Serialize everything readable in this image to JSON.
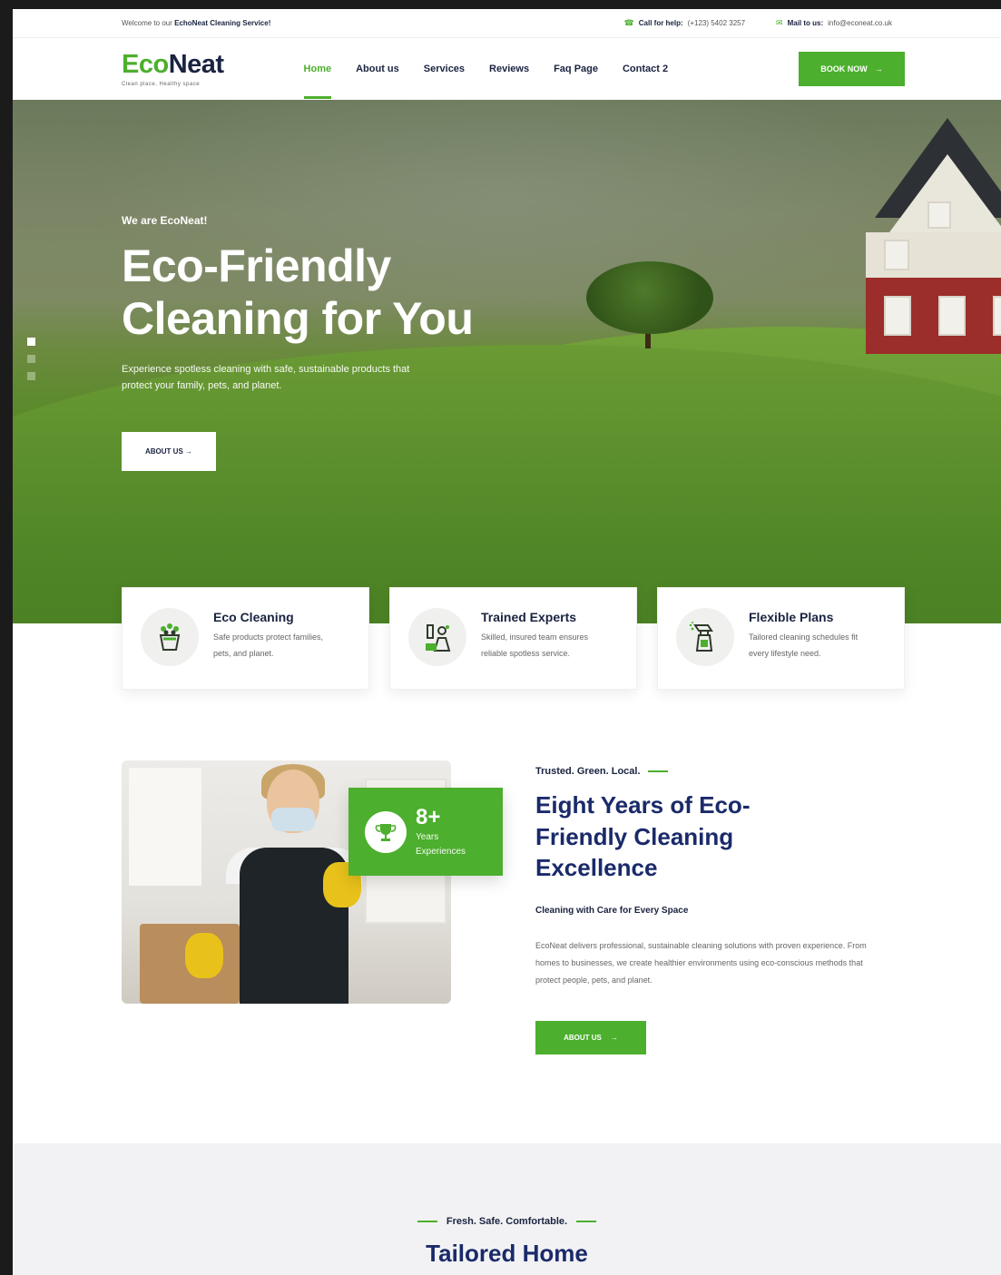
{
  "topbar": {
    "welcome_prefix": "Welcome to our ",
    "welcome_brand": "EchoNeat Cleaning Service!",
    "call_label": "Call for help:",
    "call_value": "(+123) 5402 3257",
    "mail_label": "Mail to us:",
    "mail_value": "info@econeat.co.uk"
  },
  "header": {
    "logo_eco": "Eco",
    "logo_neat": "Neat",
    "logo_tagline": "Clean place, Healthy space",
    "nav": [
      "Home",
      "About us",
      "Services",
      "Reviews",
      "Faq Page",
      "Contact 2"
    ],
    "book_label": "BOOK NOW",
    "book_arrow": "→"
  },
  "hero": {
    "eyebrow": "We are EcoNeat!",
    "title_line1": "Eco-Friendly",
    "title_line2": "Cleaning for You",
    "subtitle": "Experience spotless cleaning with safe, sustainable products that protect your family, pets, and planet.",
    "button_label": "ABOUT US →"
  },
  "features": [
    {
      "title": "Eco Cleaning",
      "desc": "Safe products protect families, pets, and planet.",
      "icon": "plant-bucket-icon"
    },
    {
      "title": "Trained Experts",
      "desc": "Skilled, insured team ensures reliable spotless service.",
      "icon": "cleaner-tools-icon"
    },
    {
      "title": "Flexible Plans",
      "desc": "Tailored cleaning schedules fit every lifestyle need.",
      "icon": "spray-bottle-icon"
    }
  ],
  "about": {
    "badge_number": "8+",
    "badge_label_1": "Years",
    "badge_label_2": "Experiences",
    "eyebrow": "Trusted. Green. Local.",
    "title": "Eight Years of Eco-Friendly Cleaning Excellence",
    "subtitle": "Cleaning with Care for Every Space",
    "description": "EcoNeat delivers professional, sustainable cleaning solutions with proven experience. From homes to businesses, we create healthier environments using eco-conscious methods that protect people, pets, and planet.",
    "button_label": "ABOUT US",
    "button_arrow": "→"
  },
  "services": {
    "eyebrow": "Fresh. Safe. Comfortable.",
    "title": "Tailored Home"
  },
  "colors": {
    "accent": "#4caf2d",
    "navy": "#1a2a6a"
  }
}
